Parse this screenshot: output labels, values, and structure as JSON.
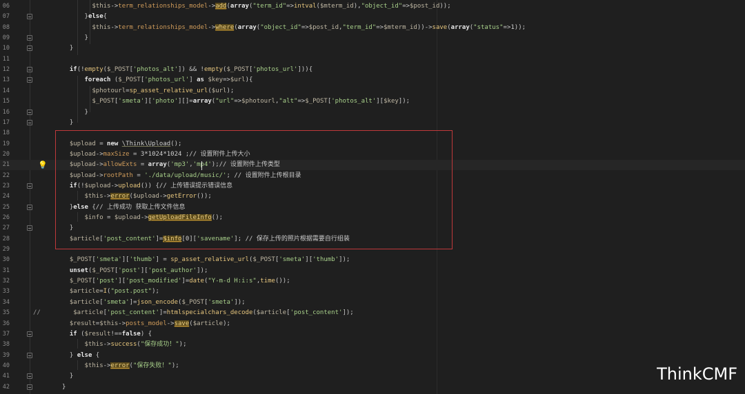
{
  "editor": {
    "lines": [
      {
        "num": "06",
        "fold": false,
        "html": "        <span class=\"v\">$this</span>-&gt;<span class=\"a\">term_relationships_model</span>-&gt;<span class=\"hl\">add</span>(<span class=\"k\">array</span>(<span class=\"s\">\"term_id\"</span>=&gt;<span class=\"f\">intval</span>(<span class=\"v\">$mterm_id</span>),<span class=\"s\">\"object_id\"</span>=&gt;<span class=\"v\">$post_id</span>));"
      },
      {
        "num": "07",
        "fold": true,
        "html": "      }<span class=\"k\">else</span>{"
      },
      {
        "num": "08",
        "fold": false,
        "html": "        <span class=\"v\">$this</span>-&gt;<span class=\"a\">term_relationships_model</span>-&gt;<span class=\"hl\">where</span>(<span class=\"k\">array</span>(<span class=\"s\">\"object_id\"</span>=&gt;<span class=\"v\">$post_id</span>,<span class=\"s\">\"term_id\"</span>=&gt;<span class=\"v\">$mterm_id</span>))-&gt;<span class=\"f\">save</span>(<span class=\"k\">array</span>(<span class=\"s\">\"status\"</span>=&gt;<span class=\"n\">1</span>));"
      },
      {
        "num": "09",
        "fold": true,
        "html": "      }"
      },
      {
        "num": "10",
        "fold": true,
        "html": "  }"
      },
      {
        "num": "11",
        "fold": false,
        "html": ""
      },
      {
        "num": "12",
        "fold": true,
        "html": "  <span class=\"k\">if</span>(!<span class=\"f\">empty</span>(<span class=\"v\">$_POST</span>[<span class=\"s\">'photos_alt'</span>]) &amp;&amp; !<span class=\"f\">empty</span>(<span class=\"v\">$_POST</span>[<span class=\"s\">'photos_url'</span>])){"
      },
      {
        "num": "13",
        "fold": true,
        "html": "      <span class=\"k\">foreach</span> (<span class=\"v\">$_POST</span>[<span class=\"s\">'photos_url'</span>] <span class=\"k\">as</span> <span class=\"v\">$key</span>=&gt;<span class=\"v\">$url</span>){"
      },
      {
        "num": "14",
        "fold": false,
        "html": "        <span class=\"v\">$photourl</span>=<span class=\"f\">sp_asset_relative_url</span>(<span class=\"v\">$url</span>);"
      },
      {
        "num": "15",
        "fold": false,
        "html": "        <span class=\"v\">$_POST</span>[<span class=\"s\">'smeta'</span>][<span class=\"s\">'photo'</span>][]=<span class=\"k\">array</span>(<span class=\"s\">\"url\"</span>=&gt;<span class=\"v\">$photourl</span>,<span class=\"s\">\"alt\"</span>=&gt;<span class=\"v\">$_POST</span>[<span class=\"s\">'photos_alt'</span>][<span class=\"v\">$key</span>]);"
      },
      {
        "num": "16",
        "fold": true,
        "html": "      }"
      },
      {
        "num": "17",
        "fold": true,
        "html": "  }"
      },
      {
        "num": "18",
        "fold": false,
        "html": ""
      },
      {
        "num": "19",
        "fold": false,
        "html": "  <span class=\"v\">$upload</span> = <span class=\"k\">new</span> <span class=\"ns\">\\Think\\Upload</span>();"
      },
      {
        "num": "20",
        "fold": false,
        "html": "  <span class=\"v\">$upload</span>-&gt;<span class=\"a\">maxSize</span> = <span class=\"n\">3*1024*1024</span> ;<span class=\"c\">// 设置附件上传大小</span>"
      },
      {
        "num": "21",
        "fold": false,
        "current": true,
        "bulb": true,
        "html": "  <span class=\"v\">$upload</span>-&gt;<span class=\"a\">allowExts</span> = <span class=\"k\">array</span>(<span class=\"s\">'mp3'</span>,<span class=\"s\">'mp4'</span>);<span class=\"c\">// 设置附件上传类型</span>"
      },
      {
        "num": "22",
        "fold": false,
        "html": "  <span class=\"v\">$upload</span>-&gt;<span class=\"a\">rootPath</span> = <span class=\"s\">'./data/upload/music/'</span>; <span class=\"c\">// 设置附件上传根目录</span>"
      },
      {
        "num": "23",
        "fold": true,
        "html": "  <span class=\"k\">if</span>(!<span class=\"v\">$upload</span>-&gt;<span class=\"f\">upload</span>()) {<span class=\"c\">// 上传错误提示错误信息</span>"
      },
      {
        "num": "24",
        "fold": false,
        "html": "      <span class=\"v\">$this</span>-&gt;<span class=\"hl\">error</span>(<span class=\"v\">$upload</span>-&gt;<span class=\"f\">getError</span>());"
      },
      {
        "num": "25",
        "fold": true,
        "html": "  }<span class=\"k\">else</span> {<span class=\"c\">// 上传成功 获取上传文件信息</span>"
      },
      {
        "num": "26",
        "fold": false,
        "html": "      <span class=\"v\">$info</span> = <span class=\"v\">$upload</span>-&gt;<span class=\"hl\">getUploadFileInfo</span>();"
      },
      {
        "num": "27",
        "fold": true,
        "html": "  }"
      },
      {
        "num": "28",
        "fold": false,
        "html": "  <span class=\"v\">$article</span>[<span class=\"s\">'post_content'</span>]=<span class=\"hl\">$info</span>[<span class=\"n\">0</span>][<span class=\"s\">'savename'</span>]; <span class=\"c\">// 保存上传的照片根据需要自行组装</span>"
      },
      {
        "num": "29",
        "fold": false,
        "html": ""
      },
      {
        "num": "30",
        "fold": false,
        "html": "  <span class=\"v\">$_POST</span>[<span class=\"s\">'smeta'</span>][<span class=\"s\">'thumb'</span>] = <span class=\"f\">sp_asset_relative_url</span>(<span class=\"v\">$_POST</span>[<span class=\"s\">'smeta'</span>][<span class=\"s\">'thumb'</span>]);"
      },
      {
        "num": "31",
        "fold": false,
        "html": "  <span class=\"k\">unset</span>(<span class=\"v\">$_POST</span>[<span class=\"s\">'post'</span>][<span class=\"s\">'post_author'</span>]);"
      },
      {
        "num": "32",
        "fold": false,
        "html": "  <span class=\"v\">$_POST</span>[<span class=\"s\">'post'</span>][<span class=\"s\">'post_modified'</span>]=<span class=\"f\">date</span>(<span class=\"s\">\"Y-m-d H:i:s\"</span>,<span class=\"f\">time</span>());"
      },
      {
        "num": "33",
        "fold": false,
        "html": "  <span class=\"v\">$article</span>=<span class=\"f\">I</span>(<span class=\"s\">\"post.post\"</span>);"
      },
      {
        "num": "34",
        "fold": false,
        "html": "  <span class=\"v\">$article</span>[<span class=\"s\">'smeta'</span>]=<span class=\"f\">json_encode</span>(<span class=\"v\">$_POST</span>[<span class=\"s\">'smeta'</span>]);"
      },
      {
        "num": "35",
        "fold": false,
        "prefix": "//",
        "html": "   <span class=\"v\">$article</span>[<span class=\"s\">'post_content'</span>]=<span class=\"f\">htmlspecialchars_decode</span>(<span class=\"v\">$article</span>[<span class=\"s\">'post_content'</span>]);"
      },
      {
        "num": "36",
        "fold": false,
        "html": "  <span class=\"v\">$result</span>=<span class=\"v\">$this</span>-&gt;<span class=\"a\">posts_model</span>-&gt;<span class=\"hl\">save</span>(<span class=\"v\">$article</span>);"
      },
      {
        "num": "37",
        "fold": true,
        "html": "  <span class=\"k\">if</span> (<span class=\"v\">$result</span>!==<span class=\"k\">false</span>) {"
      },
      {
        "num": "38",
        "fold": false,
        "html": "      <span class=\"v\">$this</span>-&gt;<span class=\"f\">success</span>(<span class=\"s\">\"保存成功！\"</span>);"
      },
      {
        "num": "39",
        "fold": true,
        "html": "  } <span class=\"k\">else</span> {"
      },
      {
        "num": "40",
        "fold": false,
        "html": "      <span class=\"v\">$this</span>-&gt;<span class=\"hl\">error</span>(<span class=\"s\">\"保存失败！\"</span>);"
      },
      {
        "num": "41",
        "fold": true,
        "html": "  }"
      },
      {
        "num": "42",
        "fold": true,
        "html": "}"
      }
    ]
  },
  "watermark": "ThinkCMF",
  "colors": {
    "background": "#1f1f1f",
    "selection_box": "#c0393b",
    "highlight": "#5a4a1c"
  }
}
